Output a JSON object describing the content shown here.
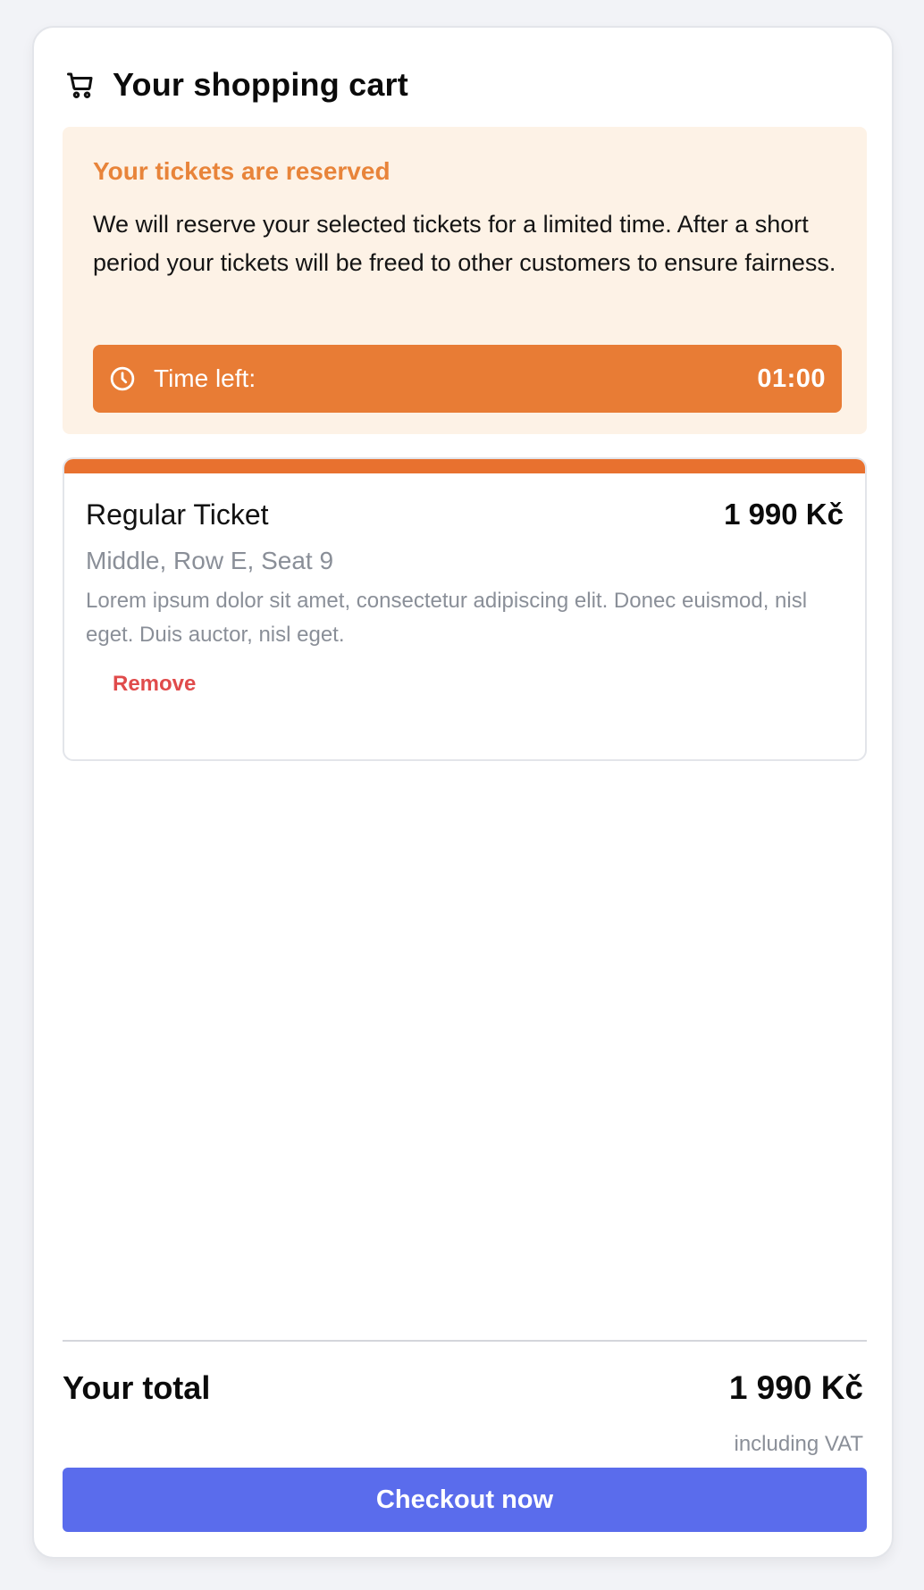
{
  "cart": {
    "title": "Your shopping cart",
    "cart_icon": "shopping-cart-icon"
  },
  "reservation": {
    "title": "Your tickets are reserved",
    "message": "We will reserve your selected tickets for a limited time. After a short period your tickets will be freed to other customers to ensure fairness.",
    "timer_label": "Time left:",
    "timer_value": "01:00",
    "timer_icon": "clock-icon",
    "colors": {
      "background": "#fdf2e6",
      "accent": "#e8843a",
      "timer_bar": "#e87c35"
    }
  },
  "items": [
    {
      "name": "Regular Ticket",
      "price": "1 990 Kč",
      "seat": "Middle, Row E, Seat 9",
      "description": "Lorem ipsum dolor sit amet, consectetur adipiscing elit. Donec euismod, nisl eget. Duis auctor, nisl eget.",
      "remove_label": "Remove",
      "accent_color": "#e8712f"
    }
  ],
  "summary": {
    "total_label": "Your total",
    "total_value": "1 990 Kč",
    "total_note": "including VAT",
    "checkout_label": "Checkout now",
    "checkout_color": "#5a6cec"
  }
}
